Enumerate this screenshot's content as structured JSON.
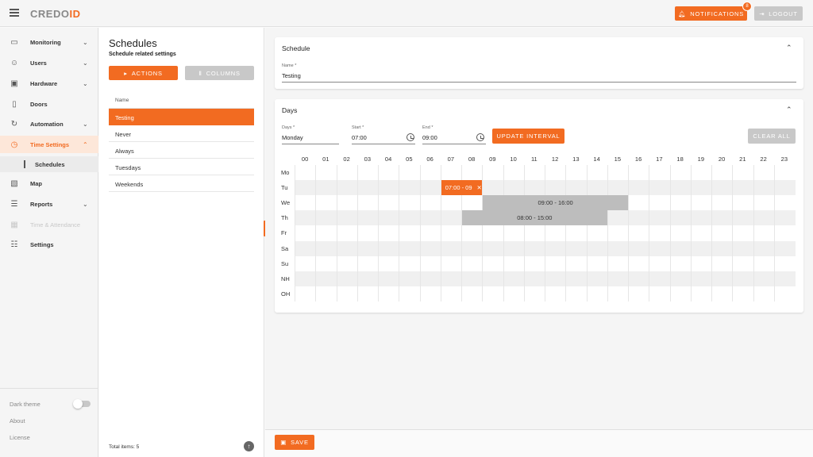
{
  "brand": {
    "logo_c": "C",
    "logo_mid": "REDO",
    "logo_end": "ID",
    "accent": "#f26b21"
  },
  "header": {
    "notifications_label": "NOTIFICATIONS",
    "notifications_count": "8",
    "logout_label": "LOGOUT"
  },
  "sidebar": {
    "items": [
      {
        "label": "Monitoring",
        "icon": "monitor-icon"
      },
      {
        "label": "Users",
        "icon": "user-icon"
      },
      {
        "label": "Hardware",
        "icon": "chip-icon"
      },
      {
        "label": "Doors",
        "icon": "door-icon"
      },
      {
        "label": "Automation",
        "icon": "sync-icon"
      },
      {
        "label": "Time Settings",
        "icon": "clock-icon"
      },
      {
        "label": "Map",
        "icon": "map-icon"
      },
      {
        "label": "Reports",
        "icon": "report-icon"
      },
      {
        "label": "Time & Attendance",
        "icon": "calendar-icon"
      },
      {
        "label": "Settings",
        "icon": "sliders-icon"
      }
    ],
    "sub_item": "Schedules",
    "dark_theme": "Dark theme",
    "about": "About",
    "license": "License"
  },
  "list": {
    "title": "Schedules",
    "subtitle": "Schedule related settings",
    "actions_label": "ACTIONS",
    "columns_label": "COLUMNS",
    "column_name": "Name",
    "rows": [
      "Testing",
      "Never",
      "Always",
      "Tuesdays",
      "Weekends"
    ],
    "total": "Total items: 5"
  },
  "schedule_card": {
    "title": "Schedule",
    "name_label": "Name *",
    "name_value": "Testing"
  },
  "days_card": {
    "title": "Days",
    "days_label": "Days *",
    "days_value": "Monday",
    "start_label": "Start *",
    "start_value": "07:00",
    "end_label": "End *",
    "end_value": "09:00",
    "update_label": "UPDATE INTERVAL",
    "clear_label": "CLEAR ALL",
    "hours": [
      "00",
      "01",
      "02",
      "03",
      "04",
      "05",
      "06",
      "07",
      "08",
      "09",
      "10",
      "11",
      "12",
      "13",
      "14",
      "15",
      "16",
      "17",
      "18",
      "19",
      "20",
      "21",
      "22",
      "23"
    ],
    "days": [
      "Mo",
      "Tu",
      "We",
      "Th",
      "Fr",
      "Sa",
      "Su",
      "NH",
      "OH"
    ],
    "intervals": [
      {
        "day": "Tu",
        "start": 7,
        "end": 9,
        "label": "07:00 - 09",
        "selected": true
      },
      {
        "day": "We",
        "start": 9,
        "end": 16,
        "label": "09:00 - 16:00",
        "selected": false
      },
      {
        "day": "Th",
        "start": 8,
        "end": 15,
        "label": "08:00 - 15:00",
        "selected": false
      }
    ]
  },
  "footer": {
    "save_label": "SAVE"
  }
}
